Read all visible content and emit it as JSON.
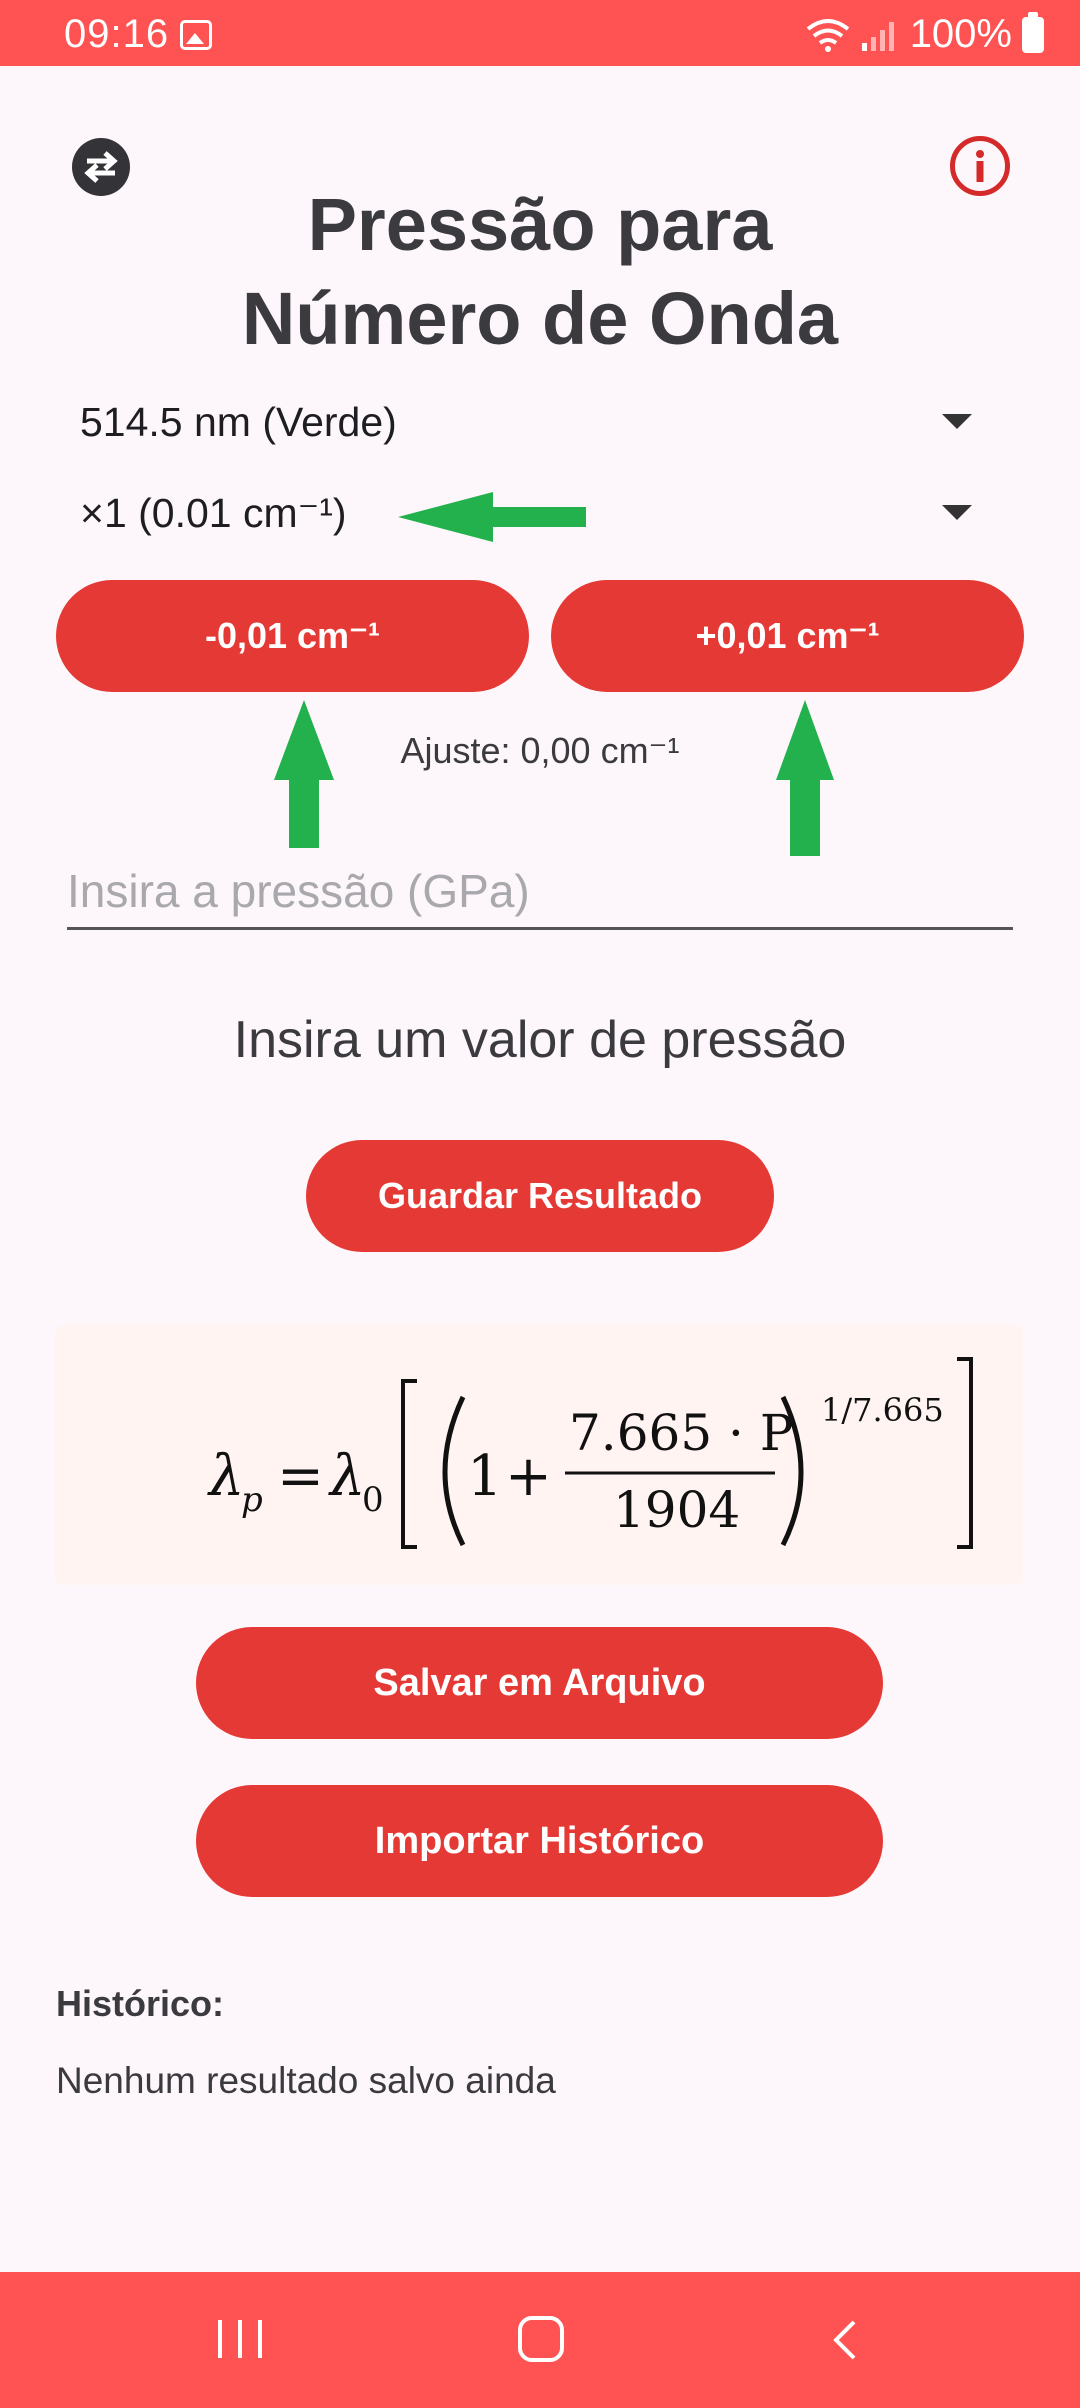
{
  "status_bar": {
    "time": "09:16",
    "battery": "100%"
  },
  "header": {
    "title_line1": "Pressão para",
    "title_line2": "Número de Onda"
  },
  "dropdowns": {
    "laser": "514.5 nm (Verde)",
    "step": "×1 (0.01 cm⁻¹)"
  },
  "buttons": {
    "minus": "-0,01 cm⁻¹",
    "plus": "+0,01 cm⁻¹",
    "save_result": "Guardar Resultado",
    "save_file": "Salvar em Arquivo",
    "import_history": "Importar Histórico"
  },
  "adjust_text": "Ajuste: 0,00 cm⁻¹",
  "pressure_input": {
    "placeholder": "Insira a pressão (GPa)",
    "value": ""
  },
  "prompt_text": "Insira um valor de pressão",
  "formula": {
    "lhs": "λp = λ0",
    "numerator": "7.665 · P",
    "denominator": "1904",
    "exponent": "1/7.665"
  },
  "history": {
    "title": "Histórico:",
    "empty": "Nenhum resultado salvo ainda"
  },
  "colors": {
    "accent": "#e53935",
    "bars": "#ff5252",
    "annotation_arrow": "#22b14c"
  },
  "icons": {
    "swap": "swap-icon",
    "info": "info-icon",
    "wifi": "wifi-icon",
    "signal": "signal-icon",
    "battery": "battery-icon",
    "gallery": "gallery-icon"
  }
}
